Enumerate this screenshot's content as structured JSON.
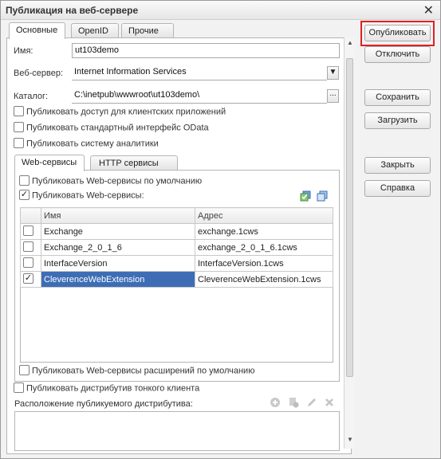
{
  "window": {
    "title": "Публикация на веб-сервере"
  },
  "tabs": [
    "Основные",
    "OpenID",
    "Прочие"
  ],
  "fields": {
    "name_label": "Имя:",
    "name_value": "ut103demo",
    "server_label": "Веб-сервер:",
    "server_value": "Internet Information Services",
    "catalog_label": "Каталог:",
    "catalog_value": "C:\\inetpub\\wwwroot\\ut103demo\\"
  },
  "checks_top": [
    {
      "label": "Публиковать доступ для клиентских приложений",
      "checked": false
    },
    {
      "label": "Публиковать стандартный интерфейс OData",
      "checked": false
    },
    {
      "label": "Публиковать систему аналитики",
      "checked": false
    }
  ],
  "inner_tabs": [
    "Web-сервисы",
    "HTTP сервисы"
  ],
  "ws": {
    "default_label": "Публиковать Web-сервисы по умолчанию",
    "default_checked": false,
    "publish_label": "Публиковать Web-сервисы:",
    "publish_checked": true,
    "columns": [
      "Имя",
      "Адрес"
    ],
    "rows": [
      {
        "checked": false,
        "name": "Exchange",
        "address": "exchange.1cws"
      },
      {
        "checked": false,
        "name": "Exchange_2_0_1_6",
        "address": "exchange_2_0_1_6.1cws"
      },
      {
        "checked": false,
        "name": "InterfaceVersion",
        "address": "InterfaceVersion.1cws"
      },
      {
        "checked": true,
        "name": "CleverenceWebExtension",
        "address": "CleverenceWebExtension.1cws"
      }
    ],
    "ext_label": "Публиковать Web-сервисы расширений по умолчанию",
    "ext_checked": false
  },
  "thin_client": {
    "label": "Публиковать дистрибутив тонкого клиента",
    "checked": false
  },
  "distr_label": "Расположение публикуемого дистрибутива:",
  "buttons": {
    "publish": "Опубликовать",
    "disable": "Отключить",
    "save": "Сохранить",
    "load": "Загрузить",
    "close": "Закрыть",
    "help": "Справка"
  },
  "colors": {
    "selection": "#3d6db5",
    "highlight": "#e02020"
  }
}
